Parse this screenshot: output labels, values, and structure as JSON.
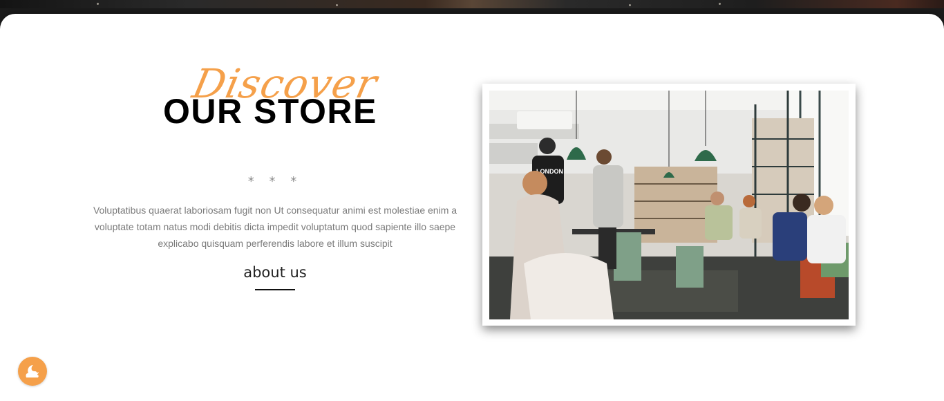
{
  "hero": {
    "script_word": "Discover",
    "title": "OUR STORE"
  },
  "divider": {
    "text": "* * *"
  },
  "content": {
    "paragraph": "Voluptatibus quaerat laboriosam fugit non Ut consequatur animi est molestiae enim a voluptate totam natus modi debitis dicta impedit voluptatum quod sapiente illo saepe explicabo quisquam perferendis labore et illum suscipit"
  },
  "link": {
    "about_label": "about us"
  },
  "photo": {
    "shirt_text": "LONDON"
  },
  "theme_toggle": {
    "icon": "moon-cloud-icon"
  },
  "colors": {
    "accent": "#f5a04a",
    "title": "#000000",
    "body_text": "#7a7a7a"
  }
}
